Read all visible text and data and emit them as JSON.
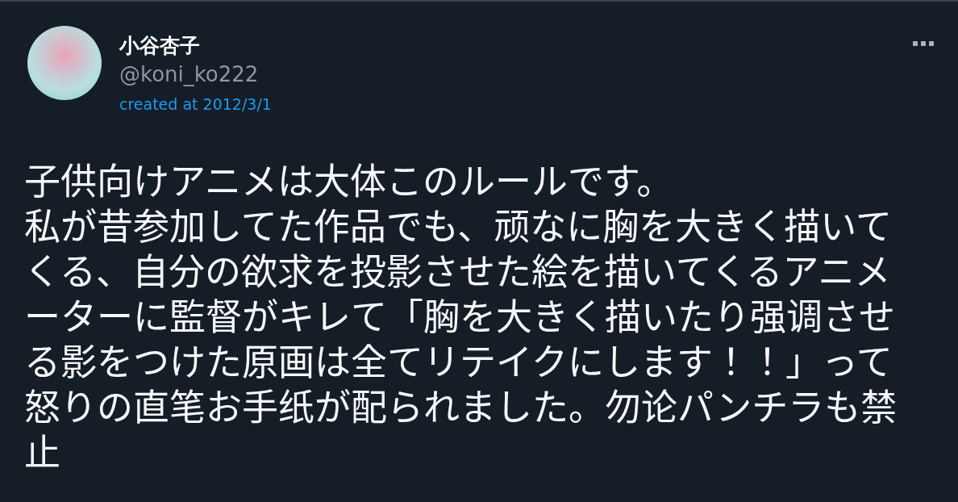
{
  "author": {
    "name": "小谷杏子",
    "handle": "@koni_ko222",
    "created": "created at 2012/3/1"
  },
  "body_lines": [
    "子供向けアニメは大体このルールです。",
    "私が昔参加してた作品でも、顽なに胸を大きく描いて",
    "くる、自分の欲求を投影させた絵を描いてくるアニメ",
    "ーターに監督がキレて「胸を大きく描いたり强调させ",
    "る影をつけた原画は全てリテイクにします！！」って",
    "怒りの直笔お手纸が配られました。勿论パンチラも禁",
    "止"
  ]
}
